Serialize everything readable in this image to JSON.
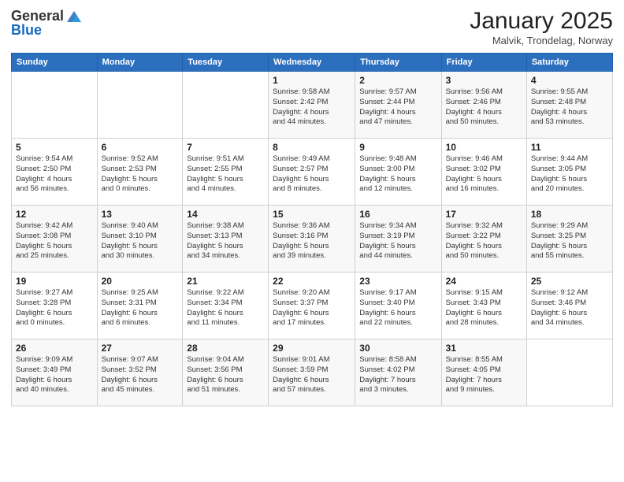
{
  "header": {
    "logo_general": "General",
    "logo_blue": "Blue",
    "title": "January 2025",
    "location": "Malvik, Trondelag, Norway"
  },
  "days_of_week": [
    "Sunday",
    "Monday",
    "Tuesday",
    "Wednesday",
    "Thursday",
    "Friday",
    "Saturday"
  ],
  "weeks": [
    [
      {
        "day": "",
        "info": ""
      },
      {
        "day": "",
        "info": ""
      },
      {
        "day": "",
        "info": ""
      },
      {
        "day": "1",
        "info": "Sunrise: 9:58 AM\nSunset: 2:42 PM\nDaylight: 4 hours\nand 44 minutes."
      },
      {
        "day": "2",
        "info": "Sunrise: 9:57 AM\nSunset: 2:44 PM\nDaylight: 4 hours\nand 47 minutes."
      },
      {
        "day": "3",
        "info": "Sunrise: 9:56 AM\nSunset: 2:46 PM\nDaylight: 4 hours\nand 50 minutes."
      },
      {
        "day": "4",
        "info": "Sunrise: 9:55 AM\nSunset: 2:48 PM\nDaylight: 4 hours\nand 53 minutes."
      }
    ],
    [
      {
        "day": "5",
        "info": "Sunrise: 9:54 AM\nSunset: 2:50 PM\nDaylight: 4 hours\nand 56 minutes."
      },
      {
        "day": "6",
        "info": "Sunrise: 9:52 AM\nSunset: 2:53 PM\nDaylight: 5 hours\nand 0 minutes."
      },
      {
        "day": "7",
        "info": "Sunrise: 9:51 AM\nSunset: 2:55 PM\nDaylight: 5 hours\nand 4 minutes."
      },
      {
        "day": "8",
        "info": "Sunrise: 9:49 AM\nSunset: 2:57 PM\nDaylight: 5 hours\nand 8 minutes."
      },
      {
        "day": "9",
        "info": "Sunrise: 9:48 AM\nSunset: 3:00 PM\nDaylight: 5 hours\nand 12 minutes."
      },
      {
        "day": "10",
        "info": "Sunrise: 9:46 AM\nSunset: 3:02 PM\nDaylight: 5 hours\nand 16 minutes."
      },
      {
        "day": "11",
        "info": "Sunrise: 9:44 AM\nSunset: 3:05 PM\nDaylight: 5 hours\nand 20 minutes."
      }
    ],
    [
      {
        "day": "12",
        "info": "Sunrise: 9:42 AM\nSunset: 3:08 PM\nDaylight: 5 hours\nand 25 minutes."
      },
      {
        "day": "13",
        "info": "Sunrise: 9:40 AM\nSunset: 3:10 PM\nDaylight: 5 hours\nand 30 minutes."
      },
      {
        "day": "14",
        "info": "Sunrise: 9:38 AM\nSunset: 3:13 PM\nDaylight: 5 hours\nand 34 minutes."
      },
      {
        "day": "15",
        "info": "Sunrise: 9:36 AM\nSunset: 3:16 PM\nDaylight: 5 hours\nand 39 minutes."
      },
      {
        "day": "16",
        "info": "Sunrise: 9:34 AM\nSunset: 3:19 PM\nDaylight: 5 hours\nand 44 minutes."
      },
      {
        "day": "17",
        "info": "Sunrise: 9:32 AM\nSunset: 3:22 PM\nDaylight: 5 hours\nand 50 minutes."
      },
      {
        "day": "18",
        "info": "Sunrise: 9:29 AM\nSunset: 3:25 PM\nDaylight: 5 hours\nand 55 minutes."
      }
    ],
    [
      {
        "day": "19",
        "info": "Sunrise: 9:27 AM\nSunset: 3:28 PM\nDaylight: 6 hours\nand 0 minutes."
      },
      {
        "day": "20",
        "info": "Sunrise: 9:25 AM\nSunset: 3:31 PM\nDaylight: 6 hours\nand 6 minutes."
      },
      {
        "day": "21",
        "info": "Sunrise: 9:22 AM\nSunset: 3:34 PM\nDaylight: 6 hours\nand 11 minutes."
      },
      {
        "day": "22",
        "info": "Sunrise: 9:20 AM\nSunset: 3:37 PM\nDaylight: 6 hours\nand 17 minutes."
      },
      {
        "day": "23",
        "info": "Sunrise: 9:17 AM\nSunset: 3:40 PM\nDaylight: 6 hours\nand 22 minutes."
      },
      {
        "day": "24",
        "info": "Sunrise: 9:15 AM\nSunset: 3:43 PM\nDaylight: 6 hours\nand 28 minutes."
      },
      {
        "day": "25",
        "info": "Sunrise: 9:12 AM\nSunset: 3:46 PM\nDaylight: 6 hours\nand 34 minutes."
      }
    ],
    [
      {
        "day": "26",
        "info": "Sunrise: 9:09 AM\nSunset: 3:49 PM\nDaylight: 6 hours\nand 40 minutes."
      },
      {
        "day": "27",
        "info": "Sunrise: 9:07 AM\nSunset: 3:52 PM\nDaylight: 6 hours\nand 45 minutes."
      },
      {
        "day": "28",
        "info": "Sunrise: 9:04 AM\nSunset: 3:56 PM\nDaylight: 6 hours\nand 51 minutes."
      },
      {
        "day": "29",
        "info": "Sunrise: 9:01 AM\nSunset: 3:59 PM\nDaylight: 6 hours\nand 57 minutes."
      },
      {
        "day": "30",
        "info": "Sunrise: 8:58 AM\nSunset: 4:02 PM\nDaylight: 7 hours\nand 3 minutes."
      },
      {
        "day": "31",
        "info": "Sunrise: 8:55 AM\nSunset: 4:05 PM\nDaylight: 7 hours\nand 9 minutes."
      },
      {
        "day": "",
        "info": ""
      }
    ]
  ]
}
